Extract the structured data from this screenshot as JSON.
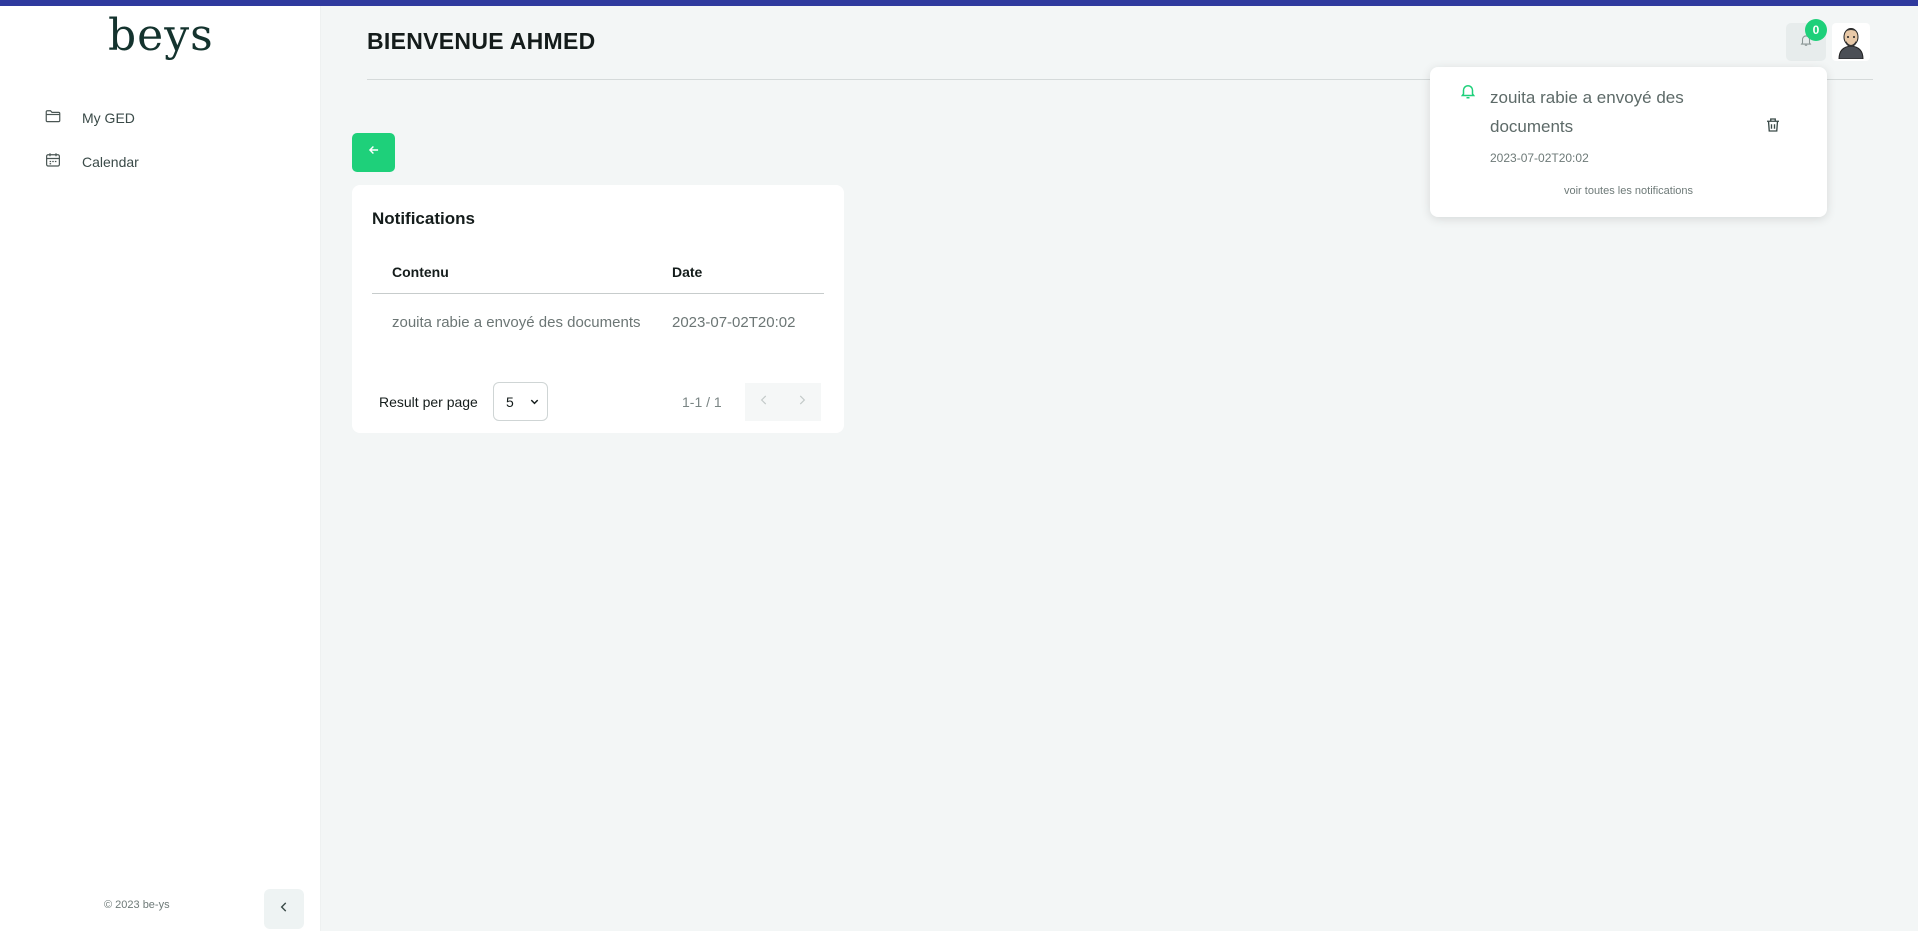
{
  "app": {
    "logo": "beys"
  },
  "sidebar": {
    "items": [
      {
        "label": "My GED",
        "icon": "folder-icon"
      },
      {
        "label": "Calendar",
        "icon": "calendar-icon"
      }
    ],
    "copyright": "© 2023 be-ys"
  },
  "header": {
    "title": "BIENVENUE AHMED",
    "notification_count": "0"
  },
  "popup": {
    "message": "zouita rabie a envoyé des documents",
    "date": "2023-07-02T20:02",
    "see_all": "voir toutes les notifications"
  },
  "card": {
    "title": "Notifications",
    "columns": [
      "Contenu",
      "Date"
    ],
    "rows": [
      {
        "content": "zouita rabie a envoyé des documents",
        "date": "2023-07-02T20:02"
      }
    ],
    "pagination": {
      "result_label": "Result per page",
      "per_page": "5",
      "range": "1-1 / 1"
    }
  },
  "colors": {
    "accent": "#1ed07a",
    "topbar": "#2f3a9e"
  }
}
